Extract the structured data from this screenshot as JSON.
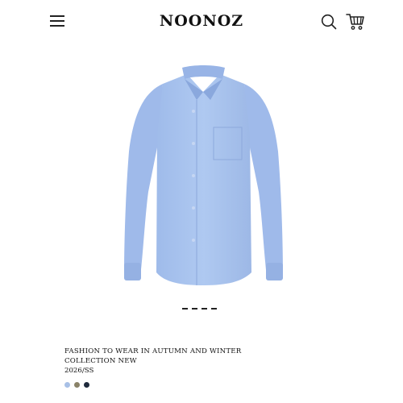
{
  "header": {
    "brand": "NOONOZ",
    "menu_icon": "hamburger-menu-icon",
    "search_icon": "search-icon",
    "cart_icon": "shopping-cart-icon"
  },
  "product": {
    "image": "light-blue-band-collar-shirt",
    "shirt_color": "#a9c4ee",
    "title_line1": "FASHION TO WEAR IN AUTUMN AND WINTER",
    "title_line2": "COLLECTION NEW",
    "season": "2026/SS",
    "swatches": [
      {
        "color": "#a8c0e6"
      },
      {
        "color": "#8a8268"
      },
      {
        "color": "#1f2a3c"
      }
    ]
  },
  "carousel": {
    "count": 4
  }
}
